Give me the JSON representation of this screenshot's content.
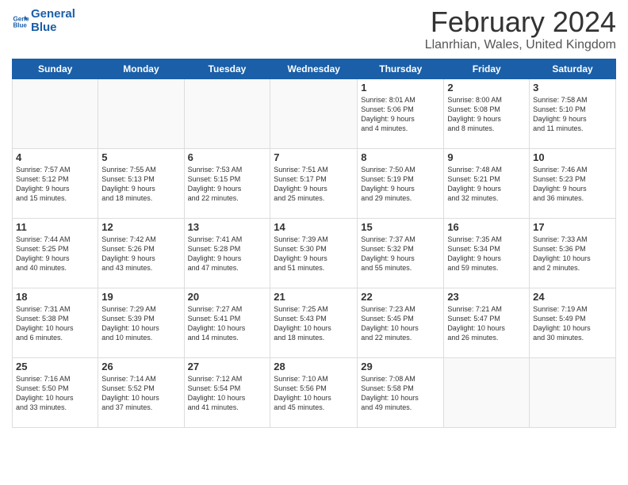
{
  "header": {
    "logo_line1": "General",
    "logo_line2": "Blue",
    "month_year": "February 2024",
    "location": "Llanrhian, Wales, United Kingdom"
  },
  "weekdays": [
    "Sunday",
    "Monday",
    "Tuesday",
    "Wednesday",
    "Thursday",
    "Friday",
    "Saturday"
  ],
  "weeks": [
    [
      {
        "day": "",
        "info": ""
      },
      {
        "day": "",
        "info": ""
      },
      {
        "day": "",
        "info": ""
      },
      {
        "day": "",
        "info": ""
      },
      {
        "day": "1",
        "info": "Sunrise: 8:01 AM\nSunset: 5:06 PM\nDaylight: 9 hours\nand 4 minutes."
      },
      {
        "day": "2",
        "info": "Sunrise: 8:00 AM\nSunset: 5:08 PM\nDaylight: 9 hours\nand 8 minutes."
      },
      {
        "day": "3",
        "info": "Sunrise: 7:58 AM\nSunset: 5:10 PM\nDaylight: 9 hours\nand 11 minutes."
      }
    ],
    [
      {
        "day": "4",
        "info": "Sunrise: 7:57 AM\nSunset: 5:12 PM\nDaylight: 9 hours\nand 15 minutes."
      },
      {
        "day": "5",
        "info": "Sunrise: 7:55 AM\nSunset: 5:13 PM\nDaylight: 9 hours\nand 18 minutes."
      },
      {
        "day": "6",
        "info": "Sunrise: 7:53 AM\nSunset: 5:15 PM\nDaylight: 9 hours\nand 22 minutes."
      },
      {
        "day": "7",
        "info": "Sunrise: 7:51 AM\nSunset: 5:17 PM\nDaylight: 9 hours\nand 25 minutes."
      },
      {
        "day": "8",
        "info": "Sunrise: 7:50 AM\nSunset: 5:19 PM\nDaylight: 9 hours\nand 29 minutes."
      },
      {
        "day": "9",
        "info": "Sunrise: 7:48 AM\nSunset: 5:21 PM\nDaylight: 9 hours\nand 32 minutes."
      },
      {
        "day": "10",
        "info": "Sunrise: 7:46 AM\nSunset: 5:23 PM\nDaylight: 9 hours\nand 36 minutes."
      }
    ],
    [
      {
        "day": "11",
        "info": "Sunrise: 7:44 AM\nSunset: 5:25 PM\nDaylight: 9 hours\nand 40 minutes."
      },
      {
        "day": "12",
        "info": "Sunrise: 7:42 AM\nSunset: 5:26 PM\nDaylight: 9 hours\nand 43 minutes."
      },
      {
        "day": "13",
        "info": "Sunrise: 7:41 AM\nSunset: 5:28 PM\nDaylight: 9 hours\nand 47 minutes."
      },
      {
        "day": "14",
        "info": "Sunrise: 7:39 AM\nSunset: 5:30 PM\nDaylight: 9 hours\nand 51 minutes."
      },
      {
        "day": "15",
        "info": "Sunrise: 7:37 AM\nSunset: 5:32 PM\nDaylight: 9 hours\nand 55 minutes."
      },
      {
        "day": "16",
        "info": "Sunrise: 7:35 AM\nSunset: 5:34 PM\nDaylight: 9 hours\nand 59 minutes."
      },
      {
        "day": "17",
        "info": "Sunrise: 7:33 AM\nSunset: 5:36 PM\nDaylight: 10 hours\nand 2 minutes."
      }
    ],
    [
      {
        "day": "18",
        "info": "Sunrise: 7:31 AM\nSunset: 5:38 PM\nDaylight: 10 hours\nand 6 minutes."
      },
      {
        "day": "19",
        "info": "Sunrise: 7:29 AM\nSunset: 5:39 PM\nDaylight: 10 hours\nand 10 minutes."
      },
      {
        "day": "20",
        "info": "Sunrise: 7:27 AM\nSunset: 5:41 PM\nDaylight: 10 hours\nand 14 minutes."
      },
      {
        "day": "21",
        "info": "Sunrise: 7:25 AM\nSunset: 5:43 PM\nDaylight: 10 hours\nand 18 minutes."
      },
      {
        "day": "22",
        "info": "Sunrise: 7:23 AM\nSunset: 5:45 PM\nDaylight: 10 hours\nand 22 minutes."
      },
      {
        "day": "23",
        "info": "Sunrise: 7:21 AM\nSunset: 5:47 PM\nDaylight: 10 hours\nand 26 minutes."
      },
      {
        "day": "24",
        "info": "Sunrise: 7:19 AM\nSunset: 5:49 PM\nDaylight: 10 hours\nand 30 minutes."
      }
    ],
    [
      {
        "day": "25",
        "info": "Sunrise: 7:16 AM\nSunset: 5:50 PM\nDaylight: 10 hours\nand 33 minutes."
      },
      {
        "day": "26",
        "info": "Sunrise: 7:14 AM\nSunset: 5:52 PM\nDaylight: 10 hours\nand 37 minutes."
      },
      {
        "day": "27",
        "info": "Sunrise: 7:12 AM\nSunset: 5:54 PM\nDaylight: 10 hours\nand 41 minutes."
      },
      {
        "day": "28",
        "info": "Sunrise: 7:10 AM\nSunset: 5:56 PM\nDaylight: 10 hours\nand 45 minutes."
      },
      {
        "day": "29",
        "info": "Sunrise: 7:08 AM\nSunset: 5:58 PM\nDaylight: 10 hours\nand 49 minutes."
      },
      {
        "day": "",
        "info": ""
      },
      {
        "day": "",
        "info": ""
      }
    ]
  ]
}
